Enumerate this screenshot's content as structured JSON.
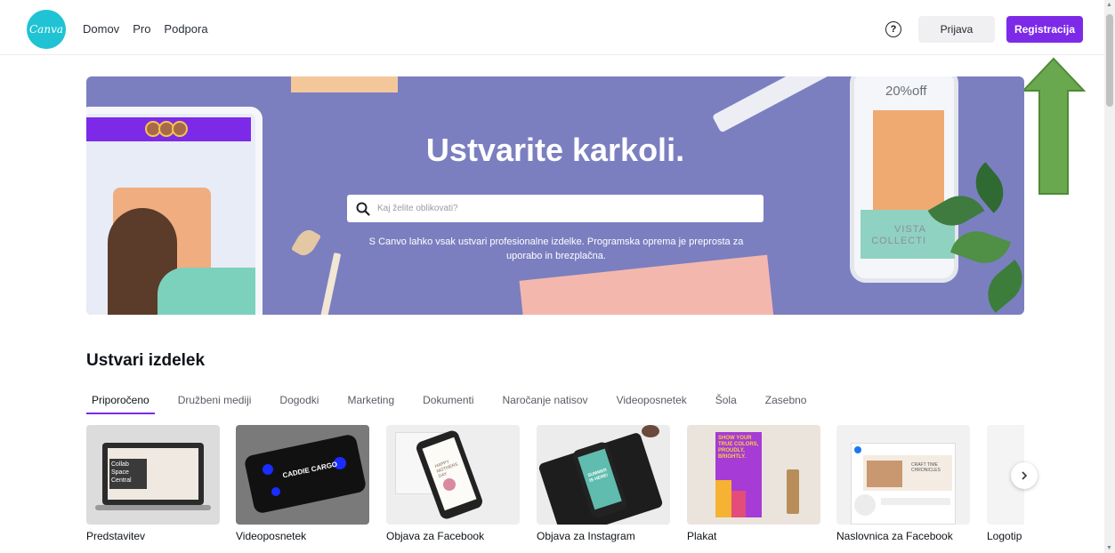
{
  "header": {
    "logo_text": "Canva",
    "nav": [
      "Domov",
      "Pro",
      "Podpora"
    ],
    "help_label": "?",
    "login_label": "Prijava",
    "register_label": "Registracija"
  },
  "hero": {
    "title": "Ustvarite karkoli.",
    "search_placeholder": "Kaj želite oblikovati?",
    "subtitle": "S Canvo lahko vsak ustvari profesionalne izdelke. Programska oprema je preprosta za uporabo in brezplačna.",
    "offer_text": "20%off",
    "vista_text": "VISTA COLLECTI"
  },
  "section": {
    "title": "Ustvari izdelek",
    "tabs": [
      "Priporočeno",
      "Družbeni mediji",
      "Dogodki",
      "Marketing",
      "Dokumenti",
      "Naročanje natisov",
      "Videoposnetek",
      "Šola",
      "Zasebno"
    ],
    "active_tab": 0
  },
  "cards": [
    {
      "label": "Predstavitev",
      "thumb_text": "Collab Space Central",
      "bg": "#dcdcdc"
    },
    {
      "label": "Videoposnetek",
      "thumb_text": "CADDIE CARGO",
      "bg": "#7a7a7a"
    },
    {
      "label": "Objava za Facebook",
      "thumb_text": "HAPPY MOTHERS DAY",
      "bg": "#eeeeee"
    },
    {
      "label": "Objava za Instagram",
      "thumb_text": "SUMMER IS HERE!",
      "bg": "#ececec"
    },
    {
      "label": "Plakat",
      "thumb_text": "SHOW YOUR TRUE COLORS, PROUDLY, BRIGHTLY.",
      "bg": "#ebe4dc"
    },
    {
      "label": "Naslovnica za Facebook",
      "thumb_text": "CRAFT TIME CHRONICLES",
      "bg": "#f1f1f1"
    },
    {
      "label": "Logotip",
      "thumb_text": "",
      "bg": "#f4f4f4"
    }
  ],
  "colors": {
    "brand_purple": "#7d2ae8",
    "logo_teal": "#1fc3d4",
    "hero_bg": "#7b7fc0",
    "annotation_arrow": "#6aa84f"
  },
  "icons": [
    "search-icon",
    "help-icon",
    "chevron-right-icon",
    "up-arrow-annotation"
  ]
}
